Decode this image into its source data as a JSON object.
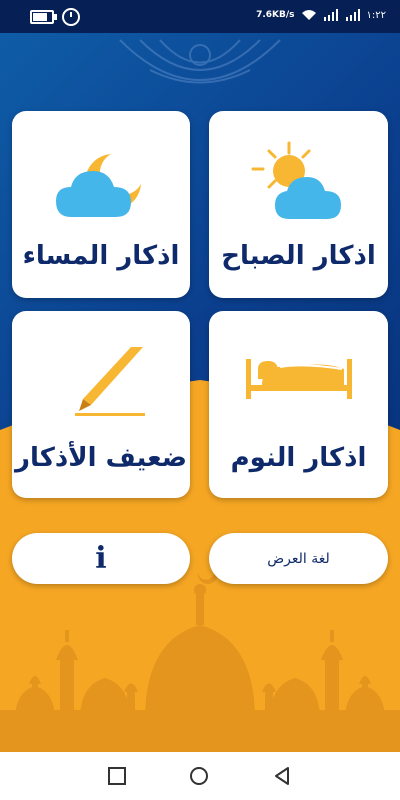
{
  "status_bar": {
    "net_speed": "7.6KB/s",
    "time": "١:٢٢",
    "battery_level": 0.8
  },
  "cards": {
    "evening": {
      "label": "اذكار المساء",
      "icon": "moon-cloud-icon"
    },
    "morning": {
      "label": "اذكار الصباح",
      "icon": "sun-cloud-icon"
    },
    "weak": {
      "label": "ضعيف الأذكار",
      "icon": "pen-icon"
    },
    "sleep": {
      "label": "اذكار النوم",
      "icon": "bed-icon"
    }
  },
  "buttons": {
    "info": {
      "label": "i",
      "icon": "info-icon"
    },
    "language": {
      "label": "لغة العرض"
    }
  },
  "colors": {
    "blue_dark": "#062a6e",
    "blue_light": "#0f5ea8",
    "orange": "#f5a623",
    "text_navy": "#0f2a6a",
    "cloud_blue": "#45b6ea",
    "sun_orange": "#f7b733"
  },
  "nav": {
    "recents_icon": "square-icon",
    "home_icon": "circle-icon",
    "back_icon": "triangle-back-icon"
  }
}
